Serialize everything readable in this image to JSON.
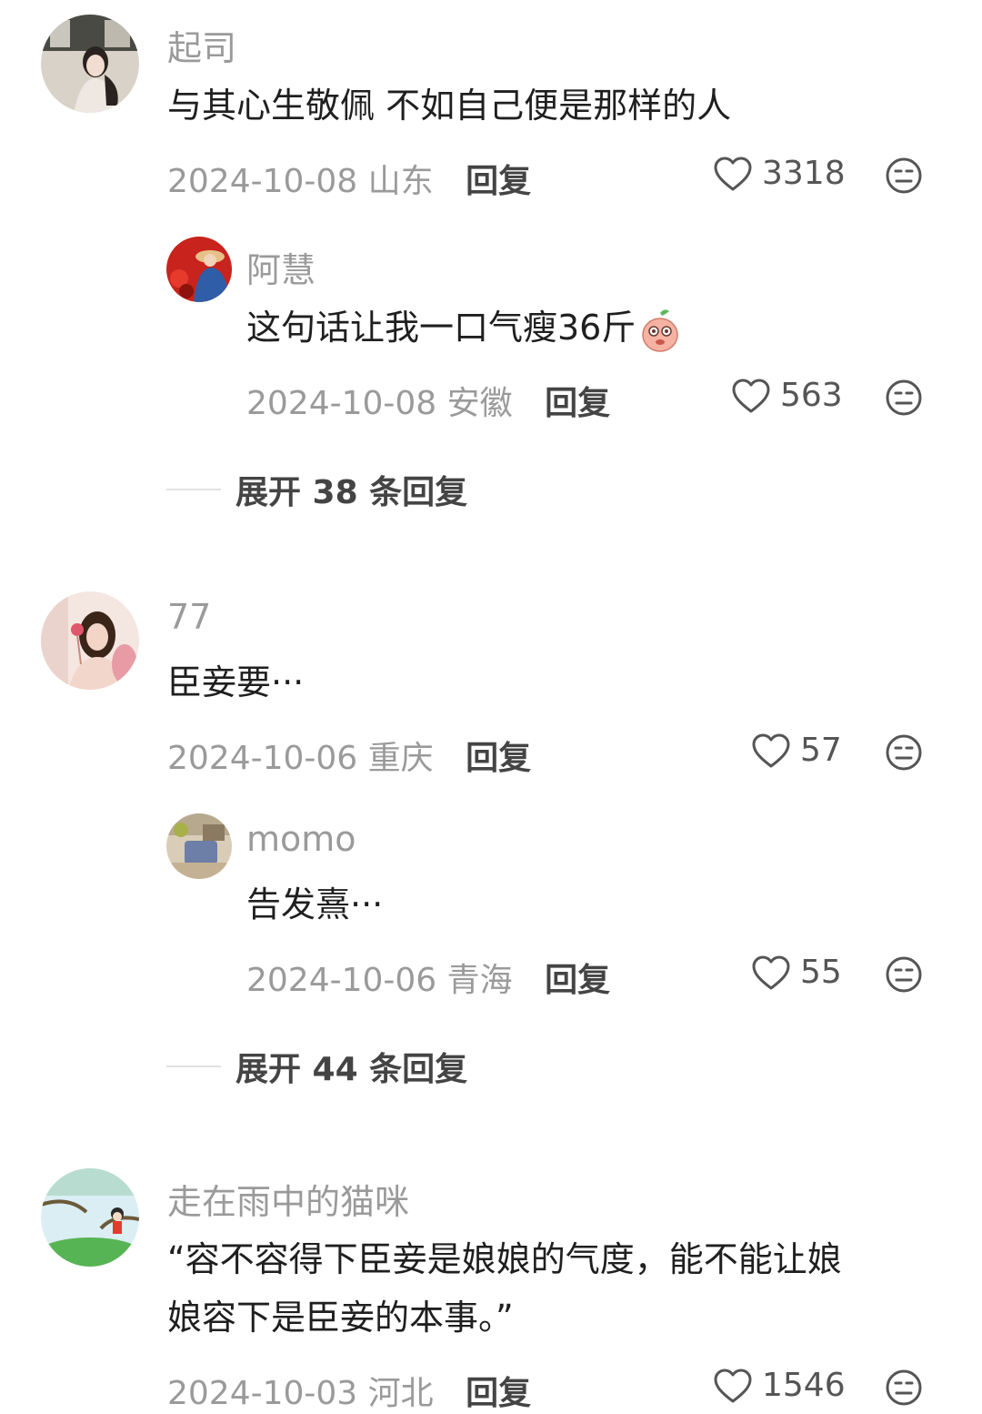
{
  "comments": [
    {
      "username": "起司",
      "text": "与其心生敬佩 不如自己便是那样的人",
      "date": "2024-10-08",
      "location": "山东",
      "reply_label": "回复",
      "likes": "3318",
      "replies": [
        {
          "username": "阿慧",
          "text": "这句话让我一口气瘦36斤",
          "date": "2024-10-08",
          "location": "安徽",
          "reply_label": "回复",
          "likes": "563"
        }
      ],
      "expand_label": "展开 38 条回复"
    },
    {
      "username": "77",
      "text": "臣妾要···",
      "date": "2024-10-06",
      "location": "重庆",
      "reply_label": "回复",
      "likes": "57",
      "replies": [
        {
          "username": "momo",
          "text": "告发熹···",
          "date": "2024-10-06",
          "location": "青海",
          "reply_label": "回复",
          "likes": "55"
        }
      ],
      "expand_label": "展开 44 条回复"
    },
    {
      "username": "走在雨中的猫咪",
      "text_line1": "“容不容得下臣妾是娘娘的气度，能不能让娘",
      "text_line2": "娘容下是臣妾的本事。”",
      "date": "2024-10-03",
      "location": "河北",
      "reply_label": "回复",
      "likes": "1546"
    }
  ],
  "icons": {
    "like": "heart-outline-icon",
    "dislike": "meh-face-icon",
    "sticker": "peach-emoji-icon"
  },
  "colors": {
    "secondary_text": "#9a9a9a",
    "primary_text": "#1f1f1f",
    "action_text": "#444444"
  }
}
